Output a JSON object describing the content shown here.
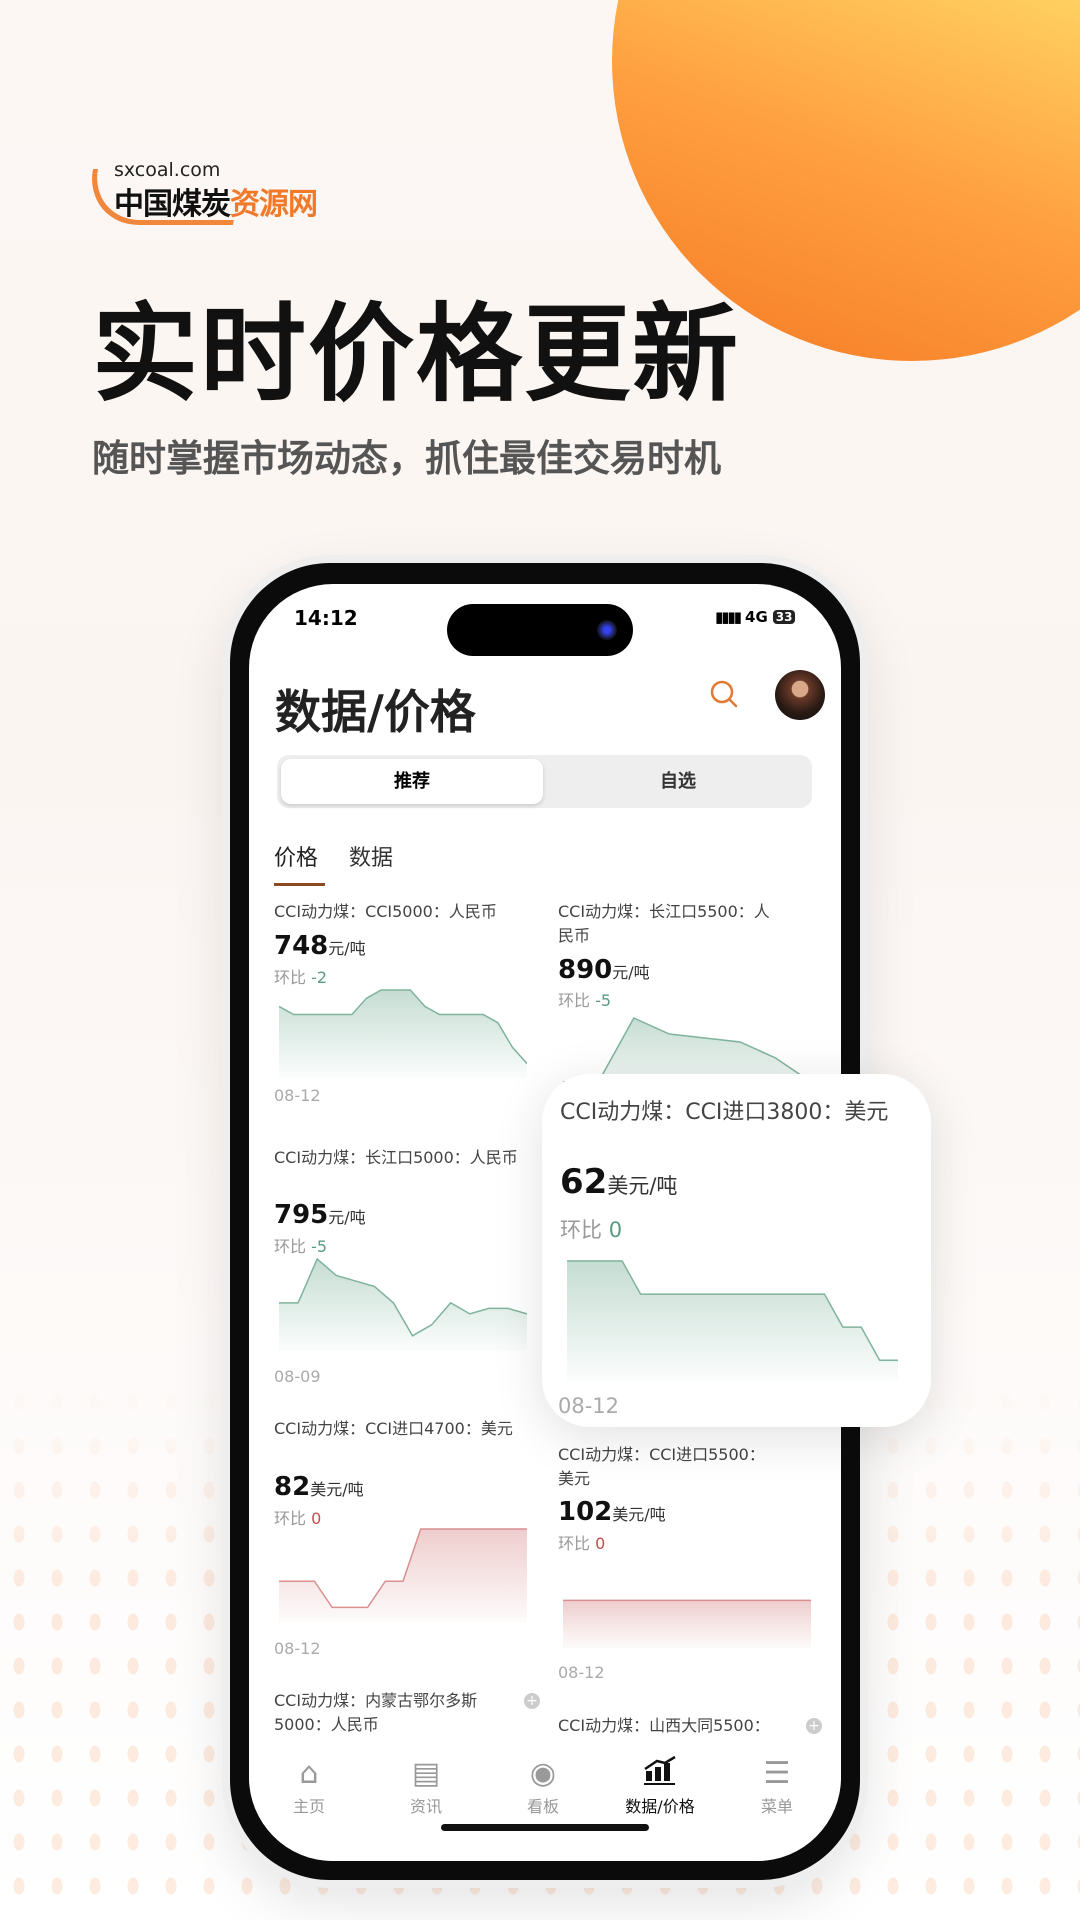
{
  "brand": {
    "domain": "sxcoal.com",
    "name_dark": "中国煤炭",
    "name_accent": "资源网",
    "accent": "#f07a2a"
  },
  "headline": "实时价格更新",
  "subheadline": "随时掌握市场动态，抓住最佳交易时机",
  "status": {
    "time": "14:12",
    "network": "4G",
    "battery": "33"
  },
  "app": {
    "title": "数据/价格",
    "segments": [
      "推荐",
      "自选"
    ],
    "tabs": [
      "价格",
      "数据"
    ],
    "cards": [
      {
        "title": "CCI动力煤：CCI5000：人民币",
        "value": "748",
        "unit": "元/吨",
        "change_label": "环比",
        "change": "-2",
        "date": "08-12",
        "trend": "down",
        "series": [
          752,
          750,
          750,
          750,
          750,
          750,
          754,
          756,
          756,
          756,
          752,
          750,
          750,
          750,
          750,
          748,
          742,
          738
        ]
      },
      {
        "title": "CCI动力煤：长江口5500：人民币",
        "value": "890",
        "unit": "元/吨",
        "change_label": "环比",
        "change": "-5",
        "trend": "down",
        "series": [
          880,
          880,
          896,
          892,
          891,
          890,
          886,
          880
        ]
      },
      {
        "title": "CCI动力煤：长江口5000：人民币",
        "value": "795",
        "unit": "元/吨",
        "change_label": "环比",
        "change": "-5",
        "date": "08-09",
        "trend": "down",
        "series": [
          795,
          795,
          803,
          800,
          799,
          798,
          795,
          789,
          791,
          795,
          793,
          794,
          794,
          793
        ]
      },
      {
        "title": "CCI动力煤：CCI进口4700：美元",
        "value": "82",
        "unit": "美元/吨",
        "change_label": "环比",
        "change": "0",
        "date": "08-12",
        "trend": "flat",
        "series": [
          81,
          81,
          81,
          80,
          80,
          80,
          81,
          81,
          83,
          83,
          83,
          83,
          83,
          83,
          83
        ]
      },
      {
        "title": "CCI动力煤：CCI进口5500：美元",
        "value": "102",
        "unit": "美元/吨",
        "change_label": "环比",
        "change": "0",
        "date": "08-12",
        "trend": "flat",
        "series": [
          102,
          102,
          102,
          102,
          102,
          102
        ]
      },
      {
        "title": "CCI动力煤：内蒙古鄂尔多斯5000：人民币"
      },
      {
        "title": "CCI动力煤：山西大同5500："
      }
    ],
    "popup": {
      "title": "CCI动力煤：CCI进口3800：美元",
      "value": "62",
      "unit": "美元/吨",
      "change_label": "环比",
      "change": "0",
      "date": "08-12",
      "series": [
        64,
        64,
        64,
        64,
        63,
        63,
        63,
        63,
        63,
        63,
        63,
        63,
        63,
        63,
        63,
        62,
        62,
        61,
        61
      ]
    },
    "nav": [
      {
        "label": "主页",
        "icon": "home-icon"
      },
      {
        "label": "资讯",
        "icon": "news-icon"
      },
      {
        "label": "看板",
        "icon": "compass-icon"
      },
      {
        "label": "数据/价格",
        "icon": "chart-icon",
        "active": true
      },
      {
        "label": "菜单",
        "icon": "menu-icon"
      }
    ]
  },
  "colors": {
    "down": "#7fb39c",
    "flat": "#d99090",
    "tab_underline": "#8b4a22"
  }
}
